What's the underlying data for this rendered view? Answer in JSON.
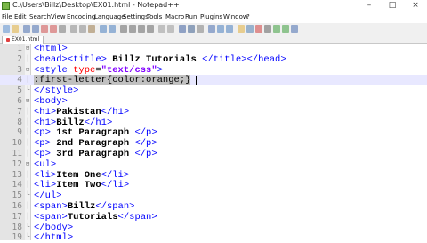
{
  "window": {
    "title": "C:\\Users\\Billz\\Desktop\\EX01.html - Notepad++",
    "buttons": [
      "–",
      "□",
      "×"
    ]
  },
  "menu": [
    "File",
    "Edit",
    "Search",
    "View",
    "Encoding",
    "Language",
    "Settings",
    "Tools",
    "Macro",
    "Run",
    "Plugins",
    "Window",
    "?"
  ],
  "toolbar": {
    "icons": [
      "new-file-icon",
      "open-file-icon",
      "save-icon",
      "save-all-icon",
      "close-icon",
      "close-all-icon",
      "print-icon",
      "cut-icon",
      "copy-icon",
      "paste-icon",
      "undo-icon",
      "redo-icon",
      "find-icon",
      "replace-icon",
      "zoom-in-icon",
      "zoom-out-icon",
      "sync-v-icon",
      "sync-h-icon",
      "word-wrap-icon",
      "show-all-icon",
      "indent-guide-icon",
      "lang-icon",
      "doc-map-icon",
      "function-list-icon",
      "folder-icon",
      "monitor-icon",
      "record-icon",
      "stop-icon",
      "play-icon",
      "play-multi-icon",
      "save-macro-icon"
    ]
  },
  "tabs": [
    {
      "label": "EX01.html"
    }
  ],
  "colors": {
    "tag": "#0000ff",
    "text": "#000000",
    "attr": "#ff0000",
    "string": "#8000ff",
    "selection": "#c0c0c0",
    "current_line": "#e8e8ff"
  },
  "editor": {
    "current_line": 4,
    "lines": [
      {
        "n": "1",
        "fold": "⊟",
        "text": "<html>"
      },
      {
        "n": "2",
        "fold": "│",
        "text": "<head><title> Billz Tutorials </title></head>"
      },
      {
        "n": "3",
        "fold": "⊟",
        "text": "<style type=\"text/css\">"
      },
      {
        "n": "4",
        "fold": "│",
        "text": ":first-letter{color:orange;}"
      },
      {
        "n": "5",
        "fold": "└",
        "text": "</style>"
      },
      {
        "n": "6",
        "fold": "⊟",
        "text": "<body>"
      },
      {
        "n": "7",
        "fold": "│",
        "text": "<h1>Pakistan</h1>"
      },
      {
        "n": "8",
        "fold": "│",
        "text": "<h1>Billz</h1>"
      },
      {
        "n": "9",
        "fold": "│",
        "text": "<p> 1st Paragraph </p>"
      },
      {
        "n": "10",
        "fold": "│",
        "text": "<p> 2nd Paragraph </p>"
      },
      {
        "n": "11",
        "fold": "│",
        "text": "<p> 3rd Paragraph </p>"
      },
      {
        "n": "12",
        "fold": "⊟",
        "text": "<ul>"
      },
      {
        "n": "13",
        "fold": "│",
        "text": "<li>Item One</li>"
      },
      {
        "n": "14",
        "fold": "│",
        "text": "<li>Item Two</li>"
      },
      {
        "n": "15",
        "fold": "└",
        "text": "</ul>"
      },
      {
        "n": "16",
        "fold": "│",
        "text": "<span>Billz</span>"
      },
      {
        "n": "17",
        "fold": "│",
        "text": "<span>Tutorials</span>"
      },
      {
        "n": "18",
        "fold": "└",
        "text": "</body>"
      },
      {
        "n": "19",
        "fold": "└",
        "text": "</html>"
      }
    ]
  }
}
